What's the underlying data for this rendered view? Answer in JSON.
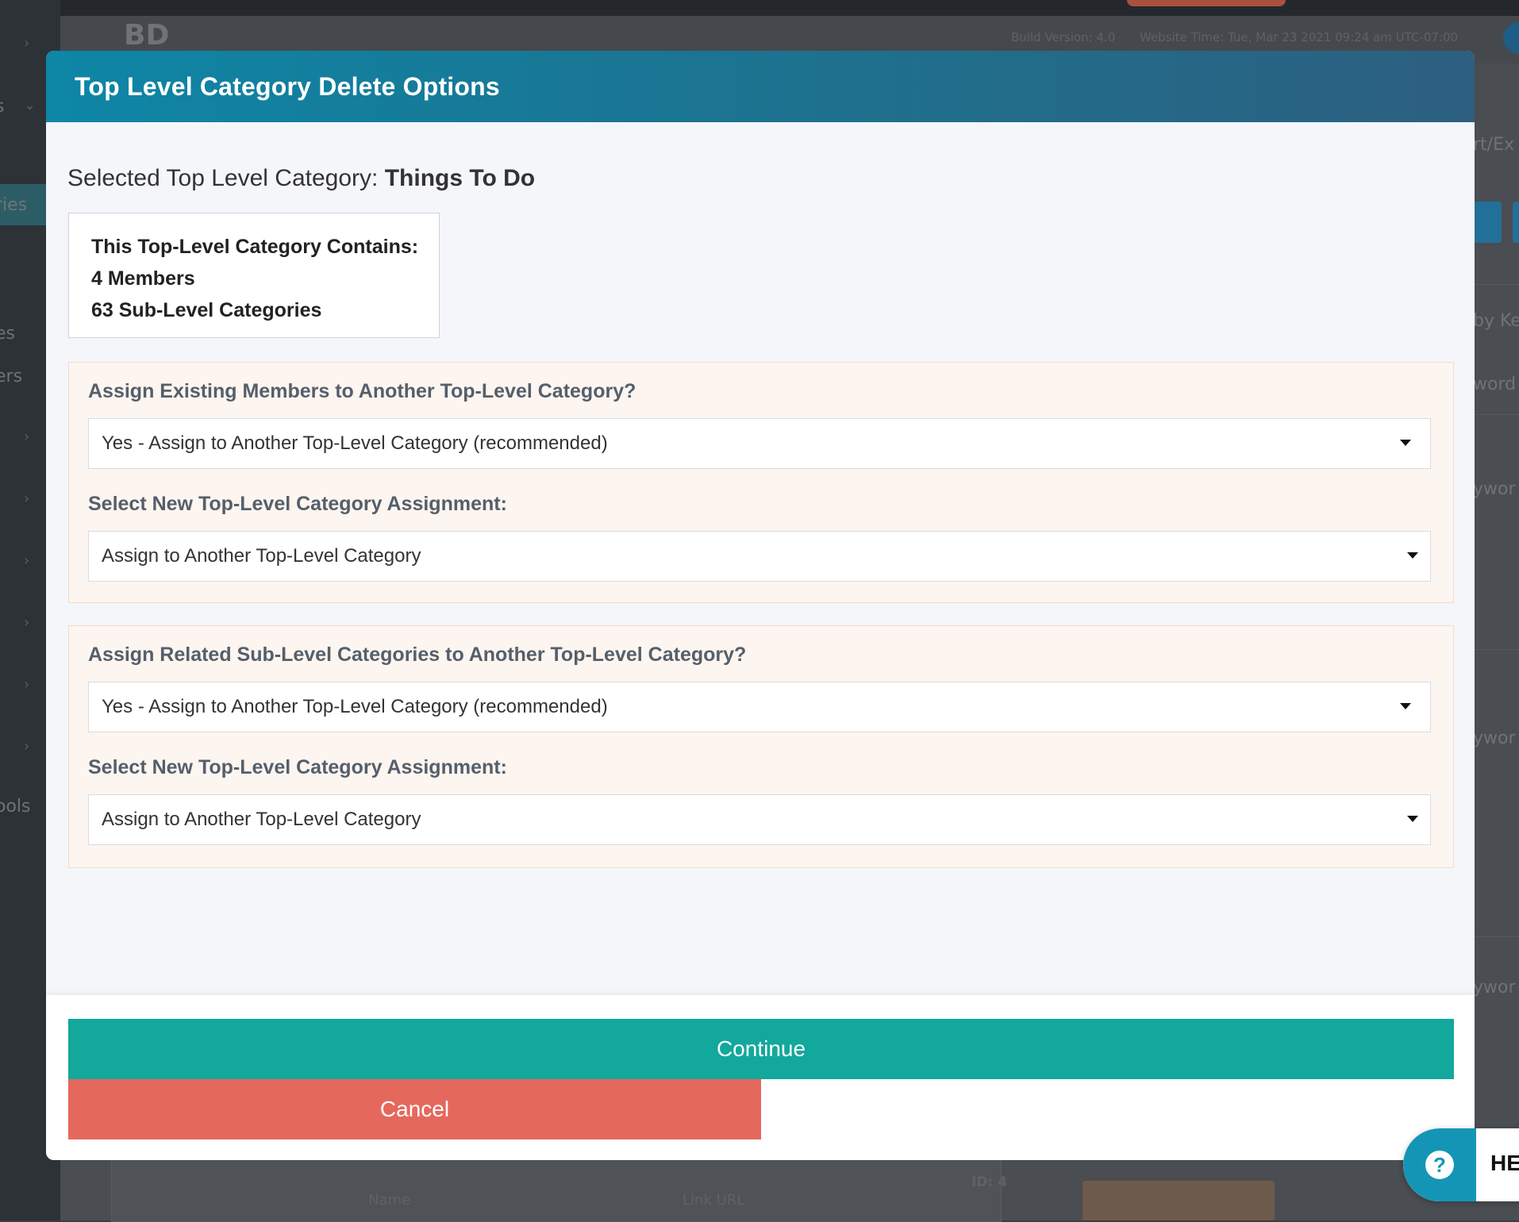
{
  "background": {
    "logo": "BD",
    "build_version": "Build Version: 4.0",
    "website_time": "Website Time: Tue, Mar 23 2021 09:24 am UTC-07:00",
    "sidebar_fragments": [
      "s",
      "ries",
      "es",
      "ers",
      "ools"
    ],
    "right_fragments": [
      "rt/Ex",
      "by Ke",
      "word",
      "ywor",
      "ywor",
      "ywor"
    ],
    "card_name": "Name",
    "card_link": "Link URL",
    "card_id": "ID: 4"
  },
  "modal": {
    "title": "Top Level Category Delete Options",
    "selected_label": "Selected Top Level Category: ",
    "selected_value": "Things To Do",
    "contains": {
      "heading": "This Top-Level Category Contains:",
      "members": "4 Members",
      "subcategories": "63 Sub-Level Categories"
    },
    "members_section": {
      "question": "Assign Existing Members to Another Top-Level Category?",
      "selected_option": "Yes - Assign to Another Top-Level Category (recommended)",
      "assignment_label": "Select New Top-Level Category Assignment:",
      "assignment_value": "Assign to Another Top-Level Category"
    },
    "subcategories_section": {
      "question": "Assign Related Sub-Level Categories to Another Top-Level Category?",
      "selected_option": "Yes - Assign to Another Top-Level Category (recommended)",
      "assignment_label": "Select New Top-Level Category Assignment:",
      "assignment_value": "Assign to Another Top-Level Category"
    },
    "continue_label": "Continue",
    "cancel_label": "Cancel"
  },
  "help_widget": {
    "icon": "question-circle-icon",
    "label": "HE"
  },
  "colors": {
    "header_start": "#0e86a6",
    "header_end": "#2d5f80",
    "continue": "#12a89c",
    "cancel": "#e5685d",
    "panel_bg": "#fdf5ef"
  }
}
